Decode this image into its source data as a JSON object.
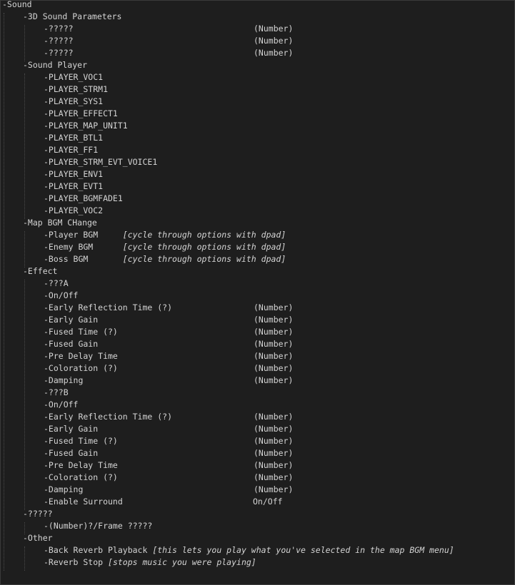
{
  "lines": [
    {
      "text": "-Sound"
    },
    {
      "text": "-3D Sound Parameters"
    },
    {
      "text": "-?????",
      "value": "(Number)"
    },
    {
      "text": "-?????",
      "value": "(Number)"
    },
    {
      "text": "-?????",
      "value": "(Number)"
    },
    {
      "text": "-Sound Player"
    },
    {
      "text": "-PLAYER_VOC1"
    },
    {
      "text": "-PLAYER_STRM1"
    },
    {
      "text": "-PLAYER_SYS1"
    },
    {
      "text": "-PLAYER_EFFECT1"
    },
    {
      "text": "-PLAYER_MAP_UNIT1"
    },
    {
      "text": "-PLAYER_BTL1"
    },
    {
      "text": "-PLAYER_FF1"
    },
    {
      "text": "-PLAYER_STRM_EVT_VOICE1"
    },
    {
      "text": "-PLAYER_ENV1"
    },
    {
      "text": "-PLAYER_EVT1"
    },
    {
      "text": "-PLAYER_BGMFADE1"
    },
    {
      "text": "-PLAYER_VOC2"
    },
    {
      "text": "-Map BGM CHange"
    },
    {
      "text": "-Player BGM     ",
      "note": "[cycle through options with dpad]"
    },
    {
      "text": "-Enemy BGM      ",
      "note": "[cycle through options with dpad]"
    },
    {
      "text": "-Boss BGM       ",
      "note": "[cycle through options with dpad]"
    },
    {
      "text": "-Effect"
    },
    {
      "text": "-???A"
    },
    {
      "text": "-On/Off"
    },
    {
      "text": "-Early Reflection Time (?)",
      "value": "(Number)"
    },
    {
      "text": "-Early Gain",
      "value": "(Number)"
    },
    {
      "text": "-Fused Time (?)",
      "value": "(Number)"
    },
    {
      "text": "-Fused Gain",
      "value": "(Number)"
    },
    {
      "text": "-Pre Delay Time",
      "value": "(Number)"
    },
    {
      "text": "-Coloration (?)",
      "value": "(Number)"
    },
    {
      "text": "-Damping",
      "value": "(Number)"
    },
    {
      "text": "-???B"
    },
    {
      "text": "-On/Off"
    },
    {
      "text": "-Early Reflection Time (?)",
      "value": "(Number)"
    },
    {
      "text": "-Early Gain",
      "value": "(Number)"
    },
    {
      "text": "-Fused Time (?)",
      "value": "(Number)"
    },
    {
      "text": "-Fused Gain",
      "value": "(Number)"
    },
    {
      "text": "-Pre Delay Time",
      "value": "(Number)"
    },
    {
      "text": "-Coloration (?)",
      "value": "(Number)"
    },
    {
      "text": "-Damping",
      "value": "(Number)"
    },
    {
      "text": "-Enable Surround",
      "value": "On/Off"
    },
    {
      "text": "-?????"
    },
    {
      "text": "-(Number)?/Frame ?????"
    },
    {
      "text": "-Other"
    },
    {
      "text": "-Back Reverb Playback ",
      "note": "[this lets you play what you've selected in the map BGM menu]"
    },
    {
      "text": "-Reverb Stop ",
      "note": "[stops music you were playing]"
    }
  ]
}
